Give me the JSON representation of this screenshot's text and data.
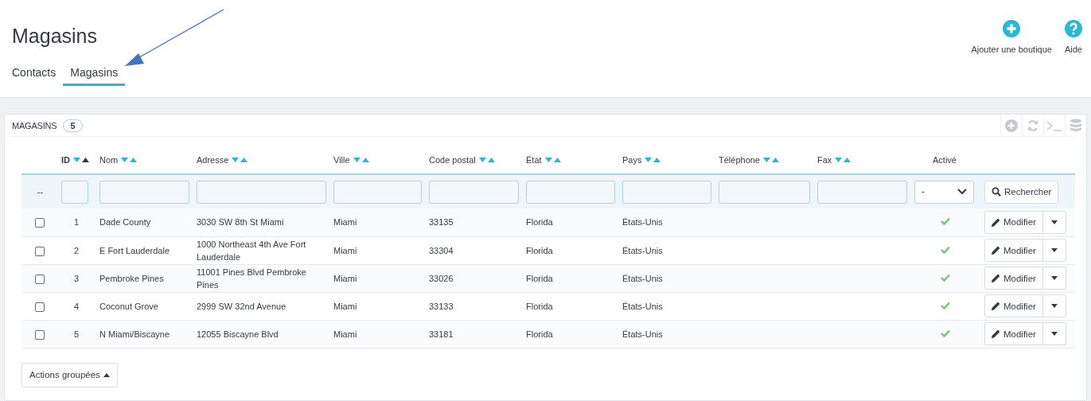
{
  "page_title": "Magasins",
  "toolbar": [
    {
      "kind": "add",
      "label": "Ajouter une boutique"
    },
    {
      "kind": "help",
      "label": "Aide"
    }
  ],
  "tabs": [
    {
      "label": "Contacts",
      "selected": false
    },
    {
      "label": "Magasins",
      "selected": true
    }
  ],
  "panel": {
    "title": "MAGASINS",
    "count": "5",
    "tools": [
      {
        "kind": "add"
      },
      {
        "kind": "refresh"
      },
      {
        "kind": "sql"
      },
      {
        "kind": "export"
      }
    ]
  },
  "table": {
    "columns": [
      {
        "label": "ID",
        "kind": "sortable",
        "sorted_ascending": true
      },
      {
        "label": "Nom",
        "kind": "sortable",
        "sorted_ascending": false
      },
      {
        "label": "Adresse",
        "kind": "sortable",
        "sorted_ascending": false
      },
      {
        "label": "Ville",
        "kind": "sortable",
        "sorted_ascending": false
      },
      {
        "label": "Code postal",
        "kind": "sortable",
        "sorted_ascending": false
      },
      {
        "label": "État",
        "kind": "sortable",
        "sorted_ascending": false
      },
      {
        "label": "Pays",
        "kind": "sortable",
        "sorted_ascending": false
      },
      {
        "label": "Téléphone",
        "kind": "sortable",
        "sorted_ascending": false
      },
      {
        "label": "Fax",
        "kind": "sortable",
        "sorted_ascending": false
      },
      {
        "label": "Activé",
        "kind": "plain"
      }
    ],
    "filters": {
      "marker": "--",
      "fields": [
        {
          "kind": "text"
        },
        {
          "kind": "text"
        },
        {
          "kind": "text"
        },
        {
          "kind": "text"
        },
        {
          "kind": "text"
        },
        {
          "kind": "text"
        },
        {
          "kind": "text"
        },
        {
          "kind": "text"
        },
        {
          "kind": "text"
        },
        {
          "kind": "select",
          "value": "-"
        }
      ],
      "search_button": "Rechercher"
    },
    "rows": [
      {
        "checked": false,
        "id": "1",
        "name": "Dade County",
        "address": "3030 SW 8th St Miami",
        "city": "Miami",
        "zip": "33135",
        "state": "Florida",
        "country": "États-Unis",
        "active": true,
        "action": "Modifier"
      },
      {
        "checked": false,
        "id": "2",
        "name": "E Fort Lauderdale",
        "address": "1000 Northeast 4th Ave Fort Lauderdale",
        "city": "Miami",
        "zip": "33304",
        "state": "Florida",
        "country": "États-Unis",
        "active": true,
        "action": "Modifier"
      },
      {
        "checked": false,
        "id": "3",
        "name": "Pembroke Pines",
        "address": "11001 Pines Blvd Pembroke Pines",
        "city": "Miami",
        "zip": "33026",
        "state": "Florida",
        "country": "États-Unis",
        "active": true,
        "action": "Modifier"
      },
      {
        "checked": false,
        "id": "4",
        "name": "Coconut Grove",
        "address": "2999 SW 32nd Avenue",
        "city": "Miami",
        "zip": "33133",
        "state": "Florida",
        "country": "États-Unis",
        "active": true,
        "action": "Modifier"
      },
      {
        "checked": false,
        "id": "5",
        "name": "N Miami/Biscayne",
        "address": "12055 Biscayne Blvd",
        "city": "Miami",
        "zip": "33181",
        "state": "Florida",
        "country": "États-Unis",
        "active": true,
        "action": "Modifier"
      }
    ]
  },
  "bulk_actions": "Actions groupées",
  "annotation": {
    "kind": "arrow"
  }
}
